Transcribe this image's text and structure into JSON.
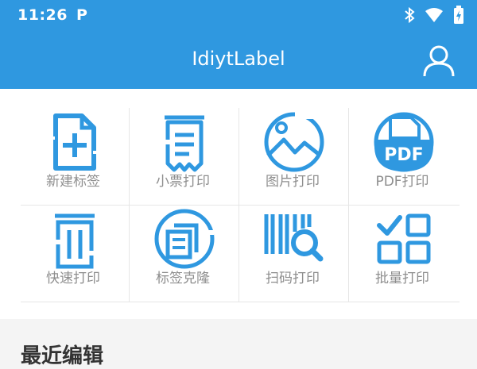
{
  "status_bar": {
    "time": "11:26",
    "notification_letter": "P"
  },
  "app_bar": {
    "title": "IdiytLabel"
  },
  "grid": {
    "items": [
      {
        "label": "新建标签",
        "icon": "new-label-icon"
      },
      {
        "label": "小票打印",
        "icon": "receipt-icon"
      },
      {
        "label": "图片打印",
        "icon": "image-icon"
      },
      {
        "label": "PDF打印",
        "icon": "pdf-icon",
        "badge_text": "PDF"
      },
      {
        "label": "快速打印",
        "icon": "fast-print-icon"
      },
      {
        "label": "标签克隆",
        "icon": "label-clone-icon"
      },
      {
        "label": "扫码打印",
        "icon": "scan-barcode-icon"
      },
      {
        "label": "批量打印",
        "icon": "batch-print-icon"
      }
    ]
  },
  "recent": {
    "title": "最近编辑"
  },
  "colors": {
    "primary": "#2f98e0",
    "label": "#8e8e8e"
  }
}
